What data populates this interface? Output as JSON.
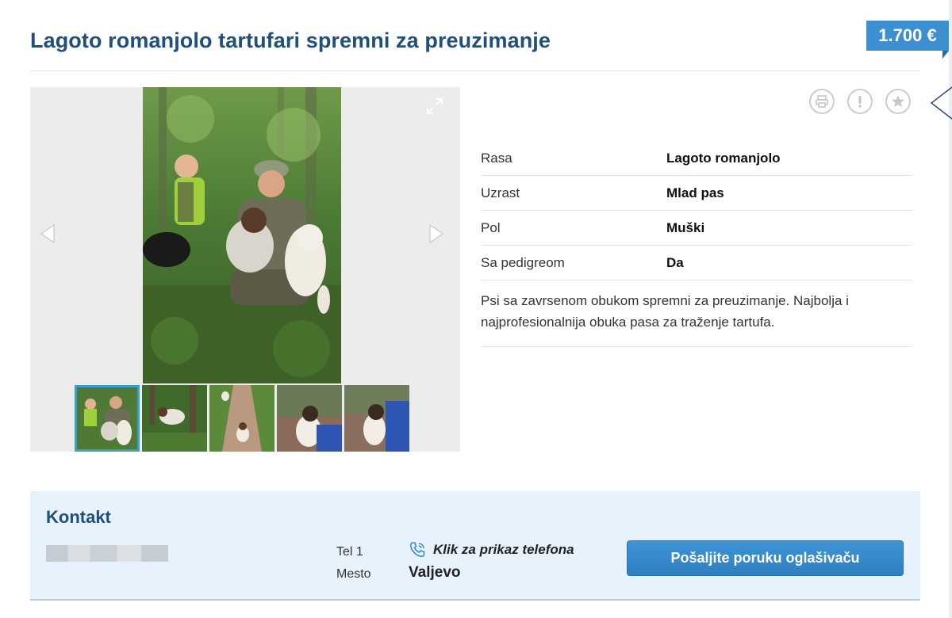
{
  "listing": {
    "title": "Lagoto romanjolo tartufari spremni za preuzimanje",
    "price": "1.700 €"
  },
  "gallery": {
    "thumbnail_count": 5,
    "active_thumbnail": 1
  },
  "details": [
    {
      "label": "Rasa",
      "value": "Lagoto romanjolo"
    },
    {
      "label": "Uzrast",
      "value": "Mlad pas"
    },
    {
      "label": "Pol",
      "value": "Muški"
    },
    {
      "label": "Sa pedigreom",
      "value": "Da"
    }
  ],
  "description": "Psi sa zavrsenom obukom spremni za preuzimanje. Najbolja i najprofesionalnija obuka pasa za traženje tartufa.",
  "icons": {
    "print": "printer-icon",
    "report": "exclamation-icon",
    "favorite": "star-icon",
    "expand": "expand-icon",
    "prev": "arrow-left-icon",
    "next": "arrow-right-icon",
    "phone": "phone-icon"
  },
  "contact": {
    "title": "Kontakt",
    "tel_label": "Tel 1",
    "phone_link": "Klik za prikaz telefona",
    "city_label": "Mesto",
    "city_value": "Valjevo",
    "message_button": "Pošaljite poruku oglašivaču"
  },
  "colors": {
    "title": "#1f4f7a",
    "price_badge": "#3d8fcf",
    "contact_bg": "#e7f2fc",
    "button": "#3585c8",
    "active_thumb_border": "#3aa0c8"
  }
}
